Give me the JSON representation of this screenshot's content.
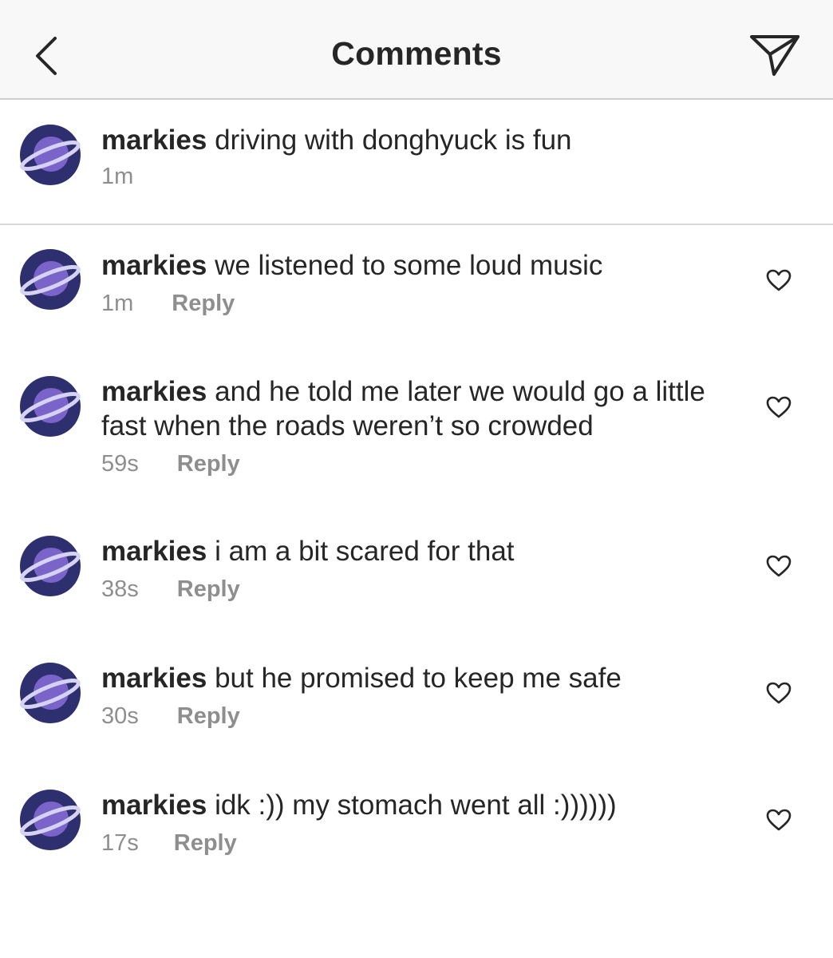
{
  "header": {
    "title": "Comments",
    "back_icon": "chevron-left-icon",
    "send_icon": "paper-plane-icon"
  },
  "caption": {
    "username": "markies",
    "text": "driving with donghyuck is fun",
    "time": "1m"
  },
  "comments": [
    {
      "username": "markies",
      "text": "we listened to some loud music",
      "time": "1m",
      "reply": "Reply"
    },
    {
      "username": "markies",
      "text": "and he told me later we would go a little fast when the roads weren’t so crowded",
      "time": "59s",
      "reply": "Reply"
    },
    {
      "username": "markies",
      "text": "i am a bit scared for that",
      "time": "38s",
      "reply": "Reply"
    },
    {
      "username": "markies",
      "text": "but he promised to keep me safe",
      "time": "30s",
      "reply": "Reply"
    },
    {
      "username": "markies",
      "text": "idk :)) my stomach went all :))))))",
      "time": "17s",
      "reply": "Reply"
    }
  ],
  "colors": {
    "text": "#262626",
    "secondary": "#8e8e8e",
    "header_bg": "#f8f8f8",
    "avatar_bg": "#2e2f6e",
    "avatar_planet": "#7a63c9",
    "avatar_ring": "#d6d3f2"
  }
}
